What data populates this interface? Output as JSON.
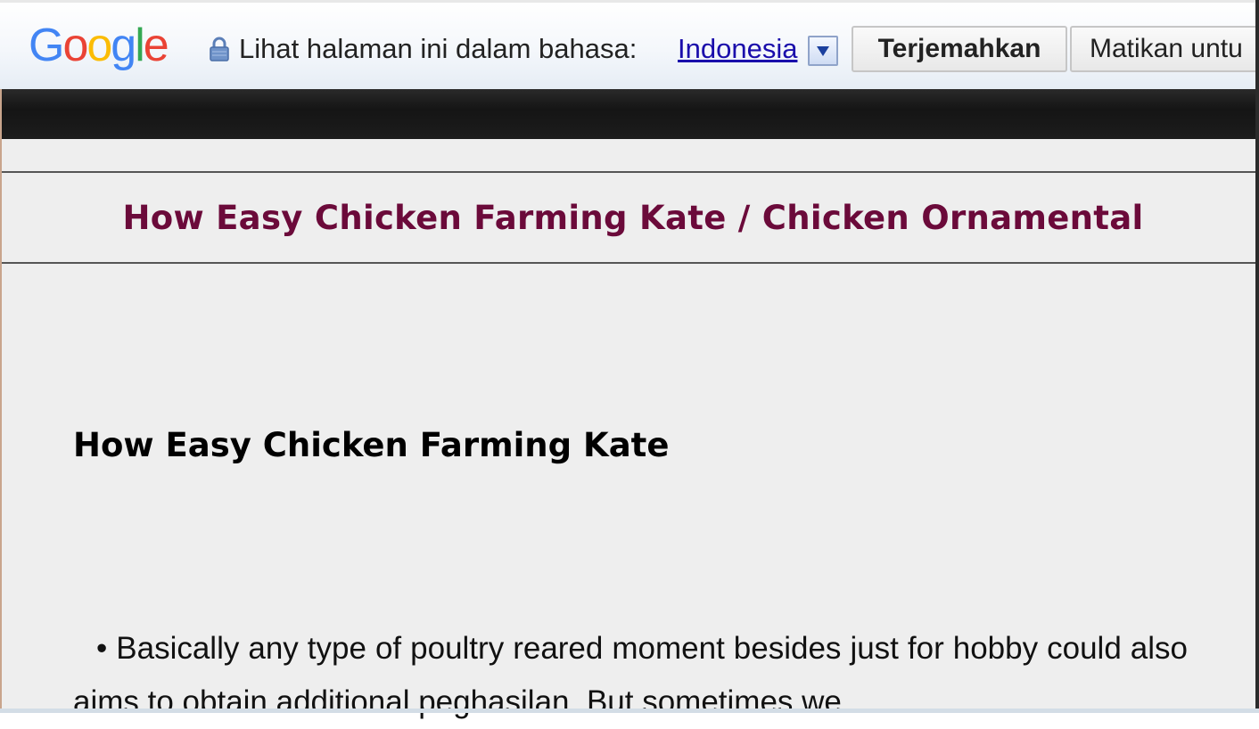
{
  "translate_bar": {
    "logo_text": "Google",
    "lock_icon": "lock-icon",
    "view_label": "Lihat halaman ini dalam bahasa:",
    "language": "Indonesia",
    "dropdown_icon": "triangle-down-icon",
    "translate_button": "Terjemahkan",
    "turn_off_button": "Matikan untu"
  },
  "page": {
    "site_title": "How Easy Chicken Farming Kate / Chicken Ornamental",
    "article_heading": "How Easy Chicken Farming Kate",
    "article_body": "• Basically any type of poultry reared moment besides just for hobby could also aims to obtain additional peghasilan. But sometimes we"
  },
  "colors": {
    "site_title": "#6b0a3a",
    "link": "#1a0dab",
    "page_background": "#eeeeee"
  }
}
